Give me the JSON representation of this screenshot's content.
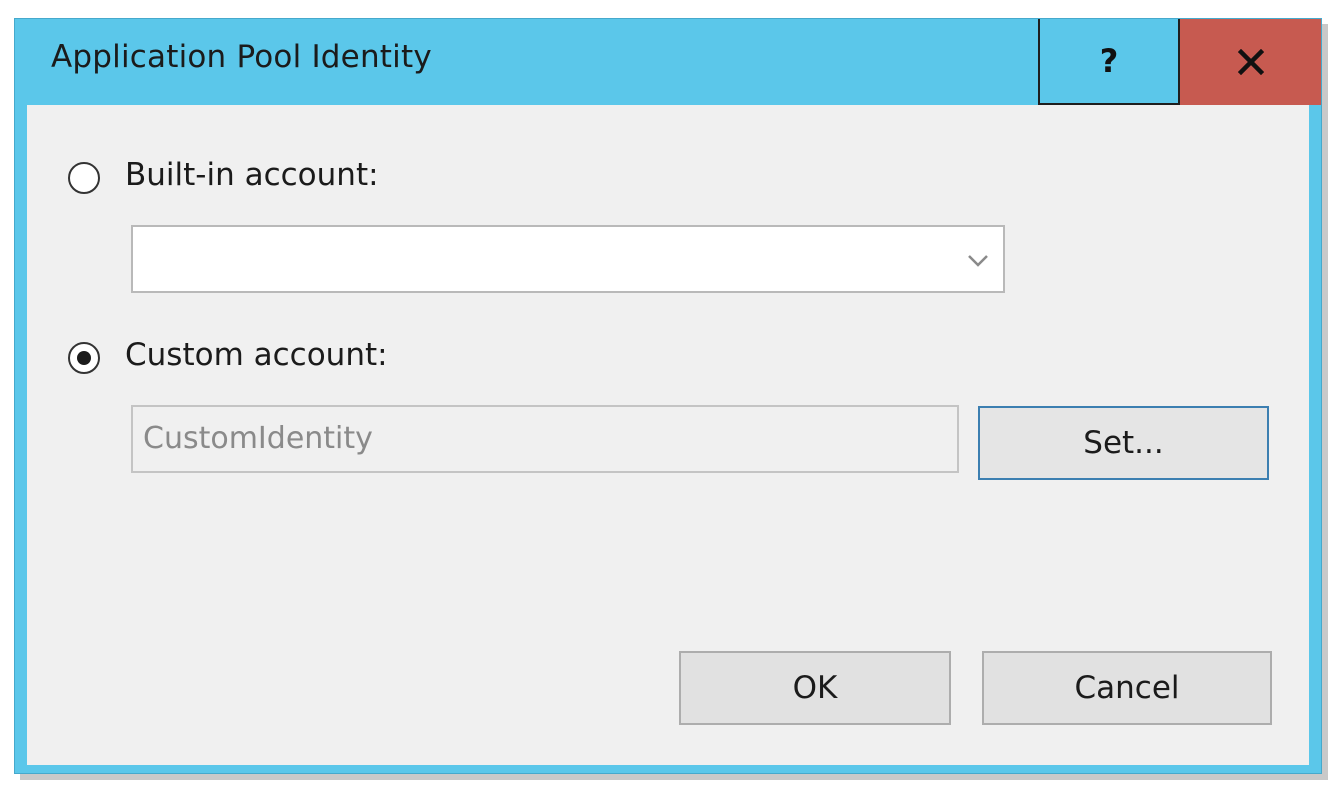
{
  "window": {
    "title": "Application Pool Identity",
    "help_label": "?",
    "colors": {
      "titlebar": "#5bc7ea",
      "close_button": "#c75a50",
      "client": "#f0f0f0"
    }
  },
  "builtin": {
    "label": "Built-in account:",
    "selected": false,
    "combo_value": ""
  },
  "custom": {
    "label": "Custom account:",
    "selected": true,
    "value": "CustomIdentity",
    "set_label": "Set..."
  },
  "footer": {
    "ok_label": "OK",
    "cancel_label": "Cancel"
  },
  "icons": {
    "help": "question-mark-icon",
    "close": "close-x-icon",
    "dropdown": "chevron-down-icon"
  }
}
